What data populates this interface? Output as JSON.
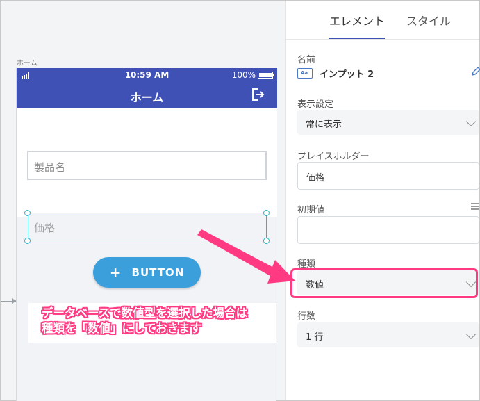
{
  "canvas": {
    "screen_caption": "ホーム"
  },
  "phone": {
    "status": {
      "time": "10:59 AM",
      "battery": "100%"
    },
    "nav_title": "ホーム",
    "product_placeholder": "製品名",
    "price_placeholder": "価格",
    "button_label": "BUTTON"
  },
  "annotation": {
    "line1": "データベースで数値型を選択した場合は",
    "line2": "種類を「数値」にしておきます",
    "color": "#ff3a82"
  },
  "panel": {
    "tabs": [
      {
        "label": "エレメント",
        "active": true
      },
      {
        "label": "スタイル",
        "active": false
      }
    ],
    "name_label": "名前",
    "name_value": "インプット 2",
    "name_icon_text": "Aa",
    "display_label": "表示設定",
    "display_value": "常に表示",
    "placeholder_label": "プレイスホルダー",
    "placeholder_value": "価格",
    "initial_label": "初期値",
    "initial_value": "",
    "type_label": "種類",
    "type_value": "数値",
    "rows_label": "行数",
    "rows_value": "1 行"
  },
  "colors": {
    "accent": "#3f51b5",
    "button": "#3b9fdc",
    "selection": "#29b6c6"
  }
}
